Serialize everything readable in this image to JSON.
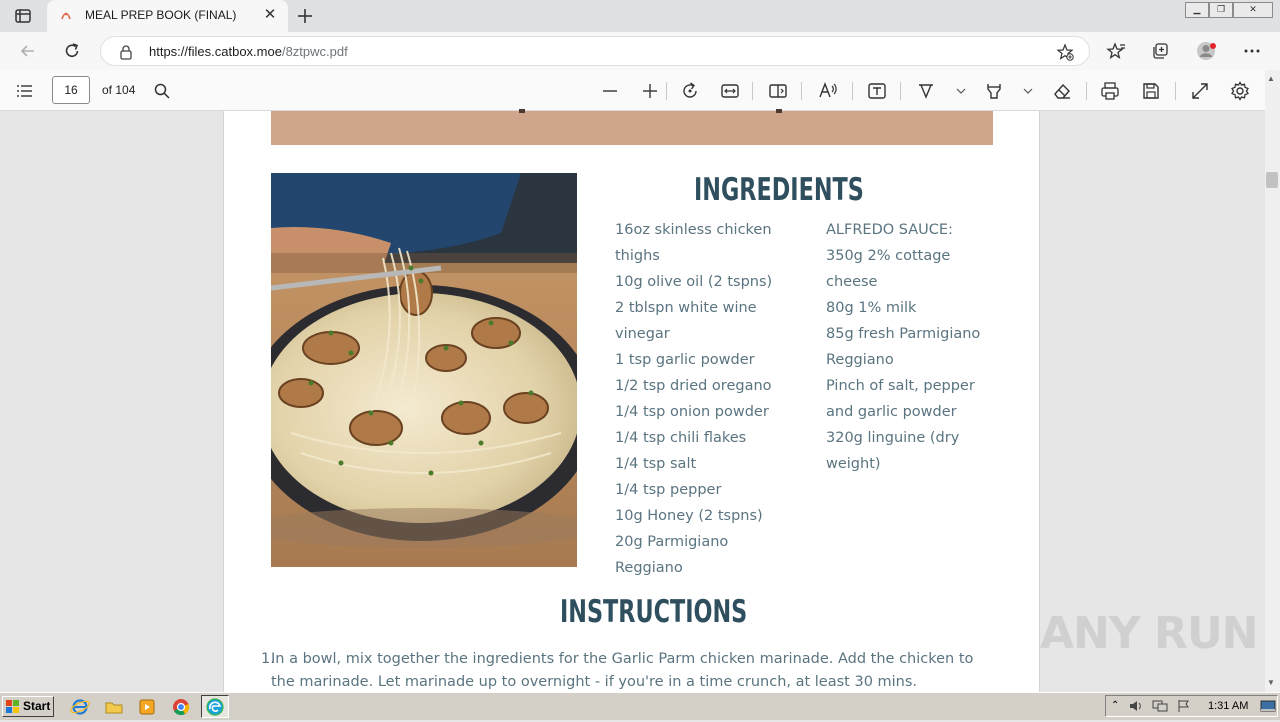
{
  "browser": {
    "tab_title": "MEAL PREP BOOK (FINAL)",
    "url_host": "https://files.catbox.moe",
    "url_path": "/8ztpwc.pdf"
  },
  "pdf_toolbar": {
    "page_number": "16",
    "page_count_label": "of 104"
  },
  "document": {
    "ingredients_heading": "INGREDIENTS",
    "ingredients_left": [
      "16oz skinless chicken",
      "thighs",
      "10g olive oil (2 tspns)",
      "2 tblspn white wine",
      "vinegar",
      "1 tsp garlic powder",
      "1/2 tsp dried oregano",
      "1/4 tsp onion powder",
      "1/4 tsp chili flakes",
      "1/4 tsp salt",
      "1/4 tsp pepper",
      "10g Honey (2 tspns)",
      "20g Parmigiano",
      "Reggiano"
    ],
    "ingredients_right": [
      "ALFREDO SAUCE:",
      "350g 2% cottage",
      "cheese",
      "80g 1% milk",
      "85g fresh Parmigiano",
      "Reggiano",
      "Pinch of salt, pepper",
      "and garlic powder",
      "320g linguine (dry",
      "weight)"
    ],
    "instructions_heading": "INSTRUCTIONS",
    "instruction_number": "1.",
    "instruction_line_1": "In a bowl, mix together the ingredients for the Garlic Parm chicken marinade. Add the chicken to",
    "instruction_line_2": "the marinade. Let marinade up to overnight - if you're in a time crunch, at least 30 mins."
  },
  "taskbar": {
    "start_label": "Start",
    "clock": "1:31 AM"
  },
  "watermark": "ANY RUN",
  "colors": {
    "heading": "#2f4f5e",
    "body_text": "#5a7480",
    "band": "#cfa58b"
  }
}
